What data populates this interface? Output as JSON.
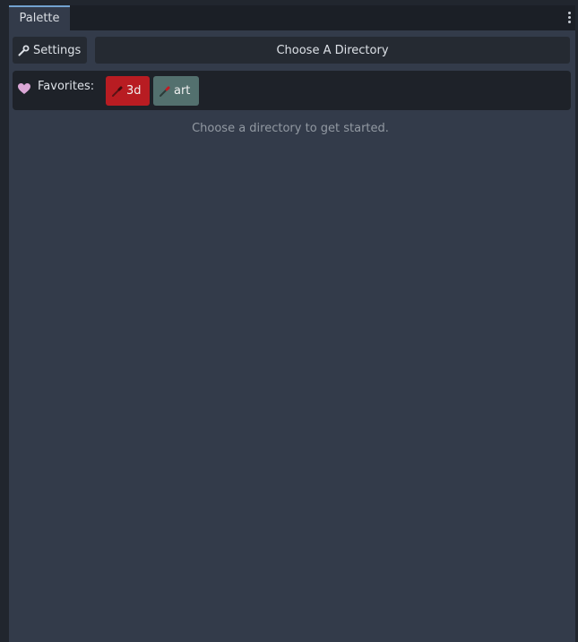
{
  "tabs": [
    {
      "label": "Palette",
      "active": true
    }
  ],
  "toolbar": {
    "settings_label": "Settings",
    "settings_icon": "wrench-icon",
    "choose_directory_label": "Choose A Directory"
  },
  "favorites": {
    "label": "Favorites:",
    "icon": "heart-icon",
    "items": [
      {
        "label": "3d",
        "color": "#b81c22",
        "icon": "brush-icon"
      },
      {
        "label": "art",
        "color": "#53706e",
        "icon": "brush-icon"
      }
    ]
  },
  "main": {
    "empty_message": "Choose a directory to get started."
  },
  "colors": {
    "accent": "#73a2cf",
    "panel_bg": "#333b4a",
    "background": "#21262e"
  }
}
